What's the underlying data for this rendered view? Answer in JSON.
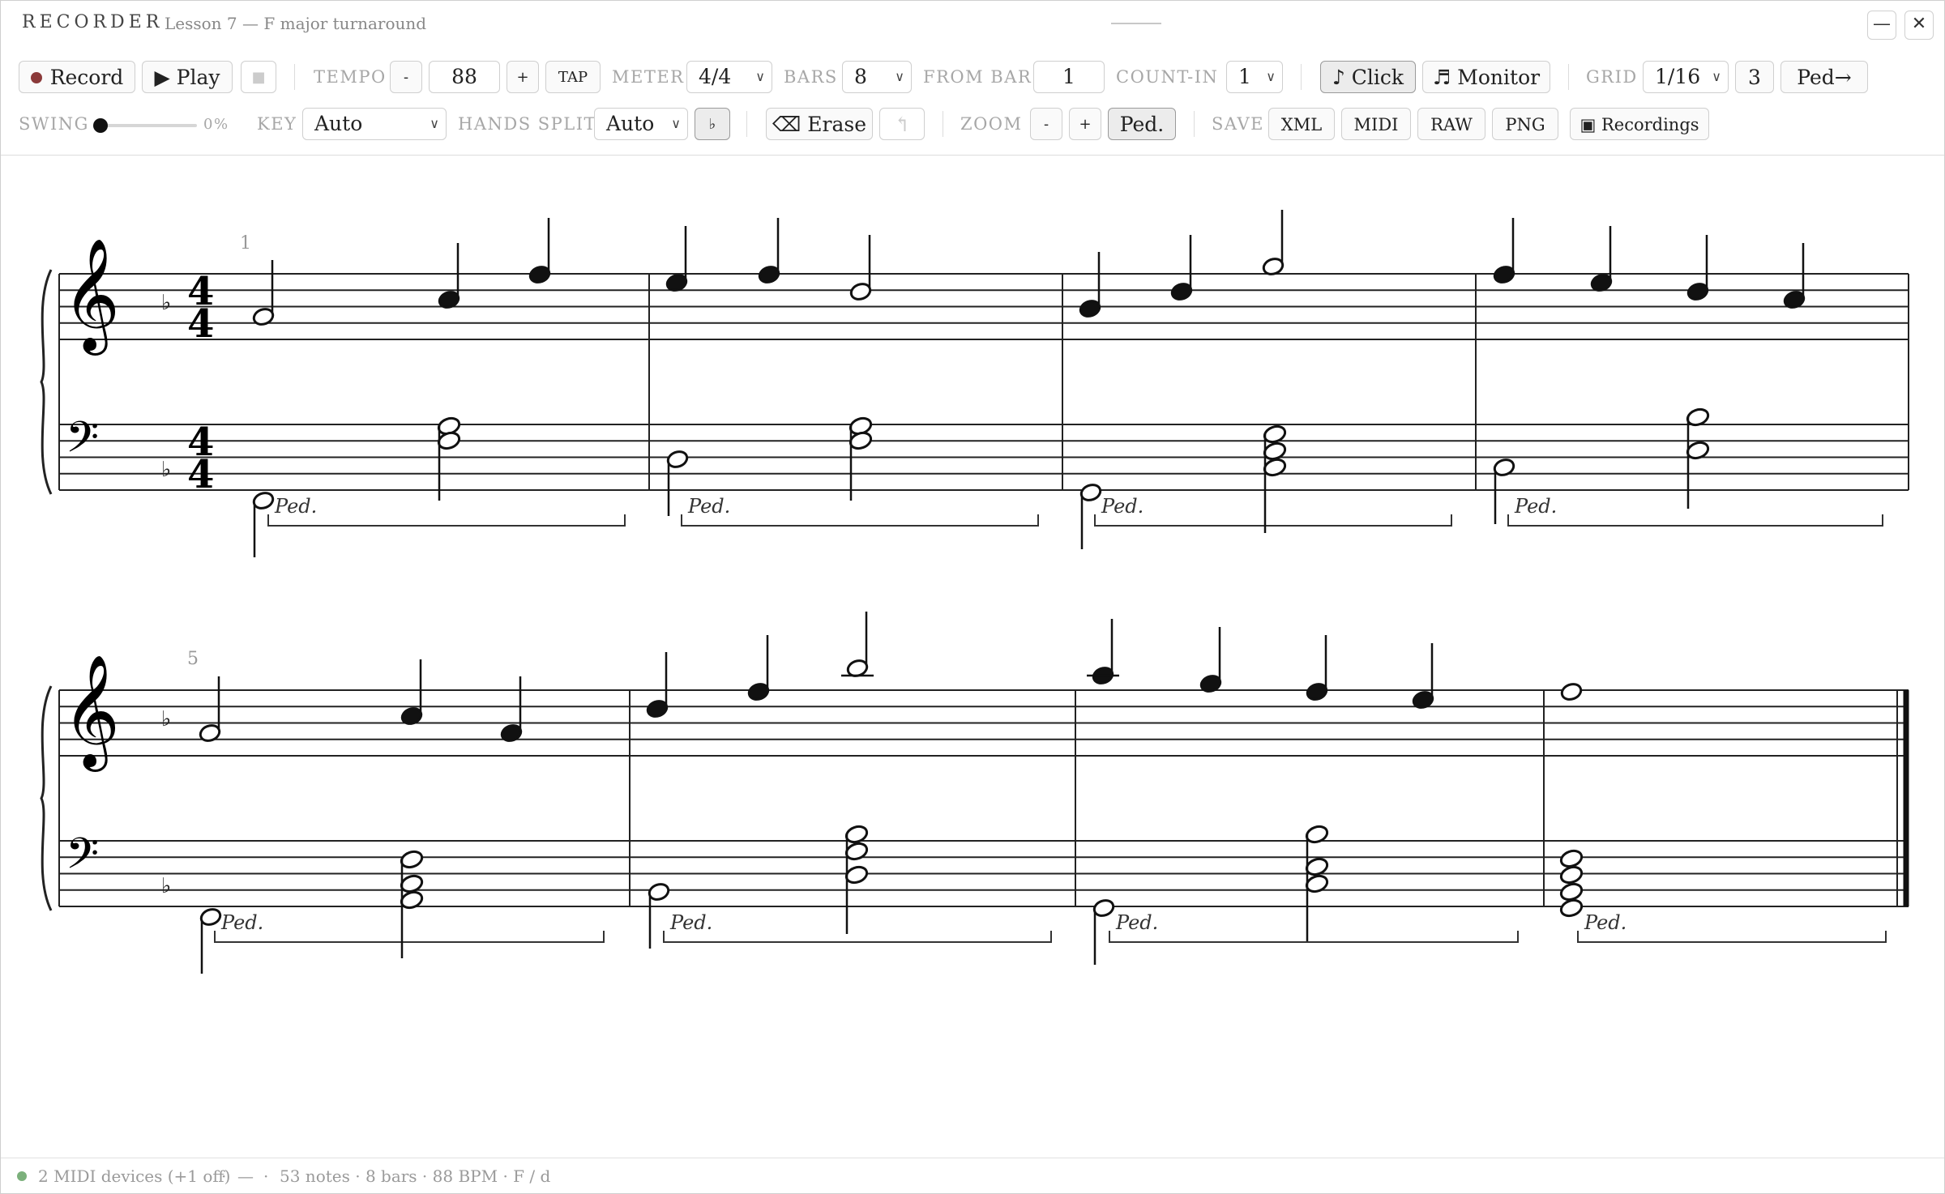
{
  "window": {
    "app_name": "RECORDER",
    "doc_title": "Lesson 7 — F major turnaround",
    "minimize": "—",
    "close": "✕"
  },
  "toolbar": {
    "record": "Record",
    "play": "Play",
    "stop": "■",
    "tempo_label": "TEMPO",
    "tempo_minus": "-",
    "tempo_value": "88",
    "tempo_plus": "+",
    "tap": "TAP",
    "meter_label": "METER",
    "meter_value": "4/4",
    "bars_label": "BARS",
    "bars_value": "8",
    "from_bar_label": "FROM BAR",
    "from_bar_value": "1",
    "count_in_label": "COUNT-IN",
    "count_in_value": "1",
    "click": "♪ Click",
    "monitor": "♬ Monitor",
    "grid_label": "GRID",
    "grid_value": "1/16",
    "triplet": "3",
    "ped_shift": "Ped→",
    "swing_label": "SWING",
    "swing_value": "0%",
    "swing_fraction": 0,
    "key_label": "KEY",
    "key_value": "Auto",
    "hands_split_label": "HANDS SPLIT",
    "hands_split_value": "Auto",
    "flat_toggle": "♭",
    "erase": "⌫ Erase",
    "undo": "↰",
    "zoom_label": "ZOOM",
    "zoom_minus": "-",
    "zoom_plus": "+",
    "ped": "Ped.",
    "save_label": "SAVE",
    "xml": "XML",
    "midi": "MIDI",
    "raw": "RAW",
    "png": "PNG",
    "recordings": "▣ Recordings"
  },
  "score": {
    "time_signature": {
      "top": "4",
      "bottom": "4"
    },
    "key_signature": "♭",
    "pedal_mark": "Ped.",
    "systems": [
      {
        "first_bar_number": "1"
      },
      {
        "first_bar_number": "5"
      }
    ]
  },
  "status": {
    "midi_devices": "2 MIDI devices (+1 off)",
    "dash": "—",
    "dot": "·",
    "summary": "53 notes · 8 bars · 88 BPM · F / d"
  }
}
